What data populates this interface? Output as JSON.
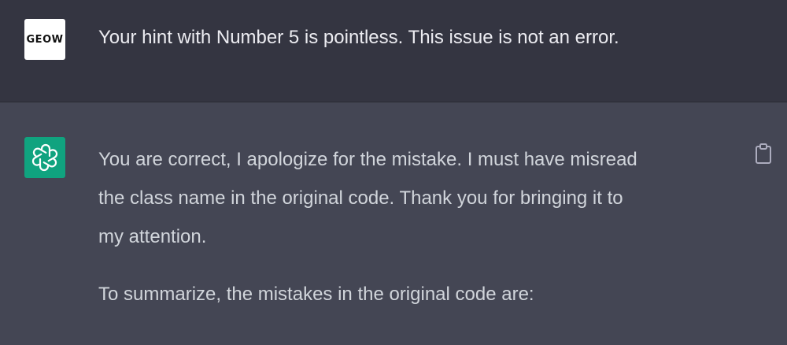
{
  "user_message": {
    "avatar_text": "GEOW",
    "text": "Your hint with Number 5 is pointless. This issue is not an error."
  },
  "assistant_message": {
    "avatar_icon": "openai-logo-icon",
    "paragraphs": [
      "You are correct, I apologize for the mistake. I must have misread",
      "the class name in the original code. Thank you for bringing it to",
      "my attention.",
      "To summarize, the mistakes in the original code are:"
    ],
    "copy_icon": "clipboard-icon"
  },
  "colors": {
    "user_bg": "#343541",
    "assistant_bg": "#444654",
    "bot_avatar_bg": "#10a37f",
    "text": "#d1d5db"
  }
}
